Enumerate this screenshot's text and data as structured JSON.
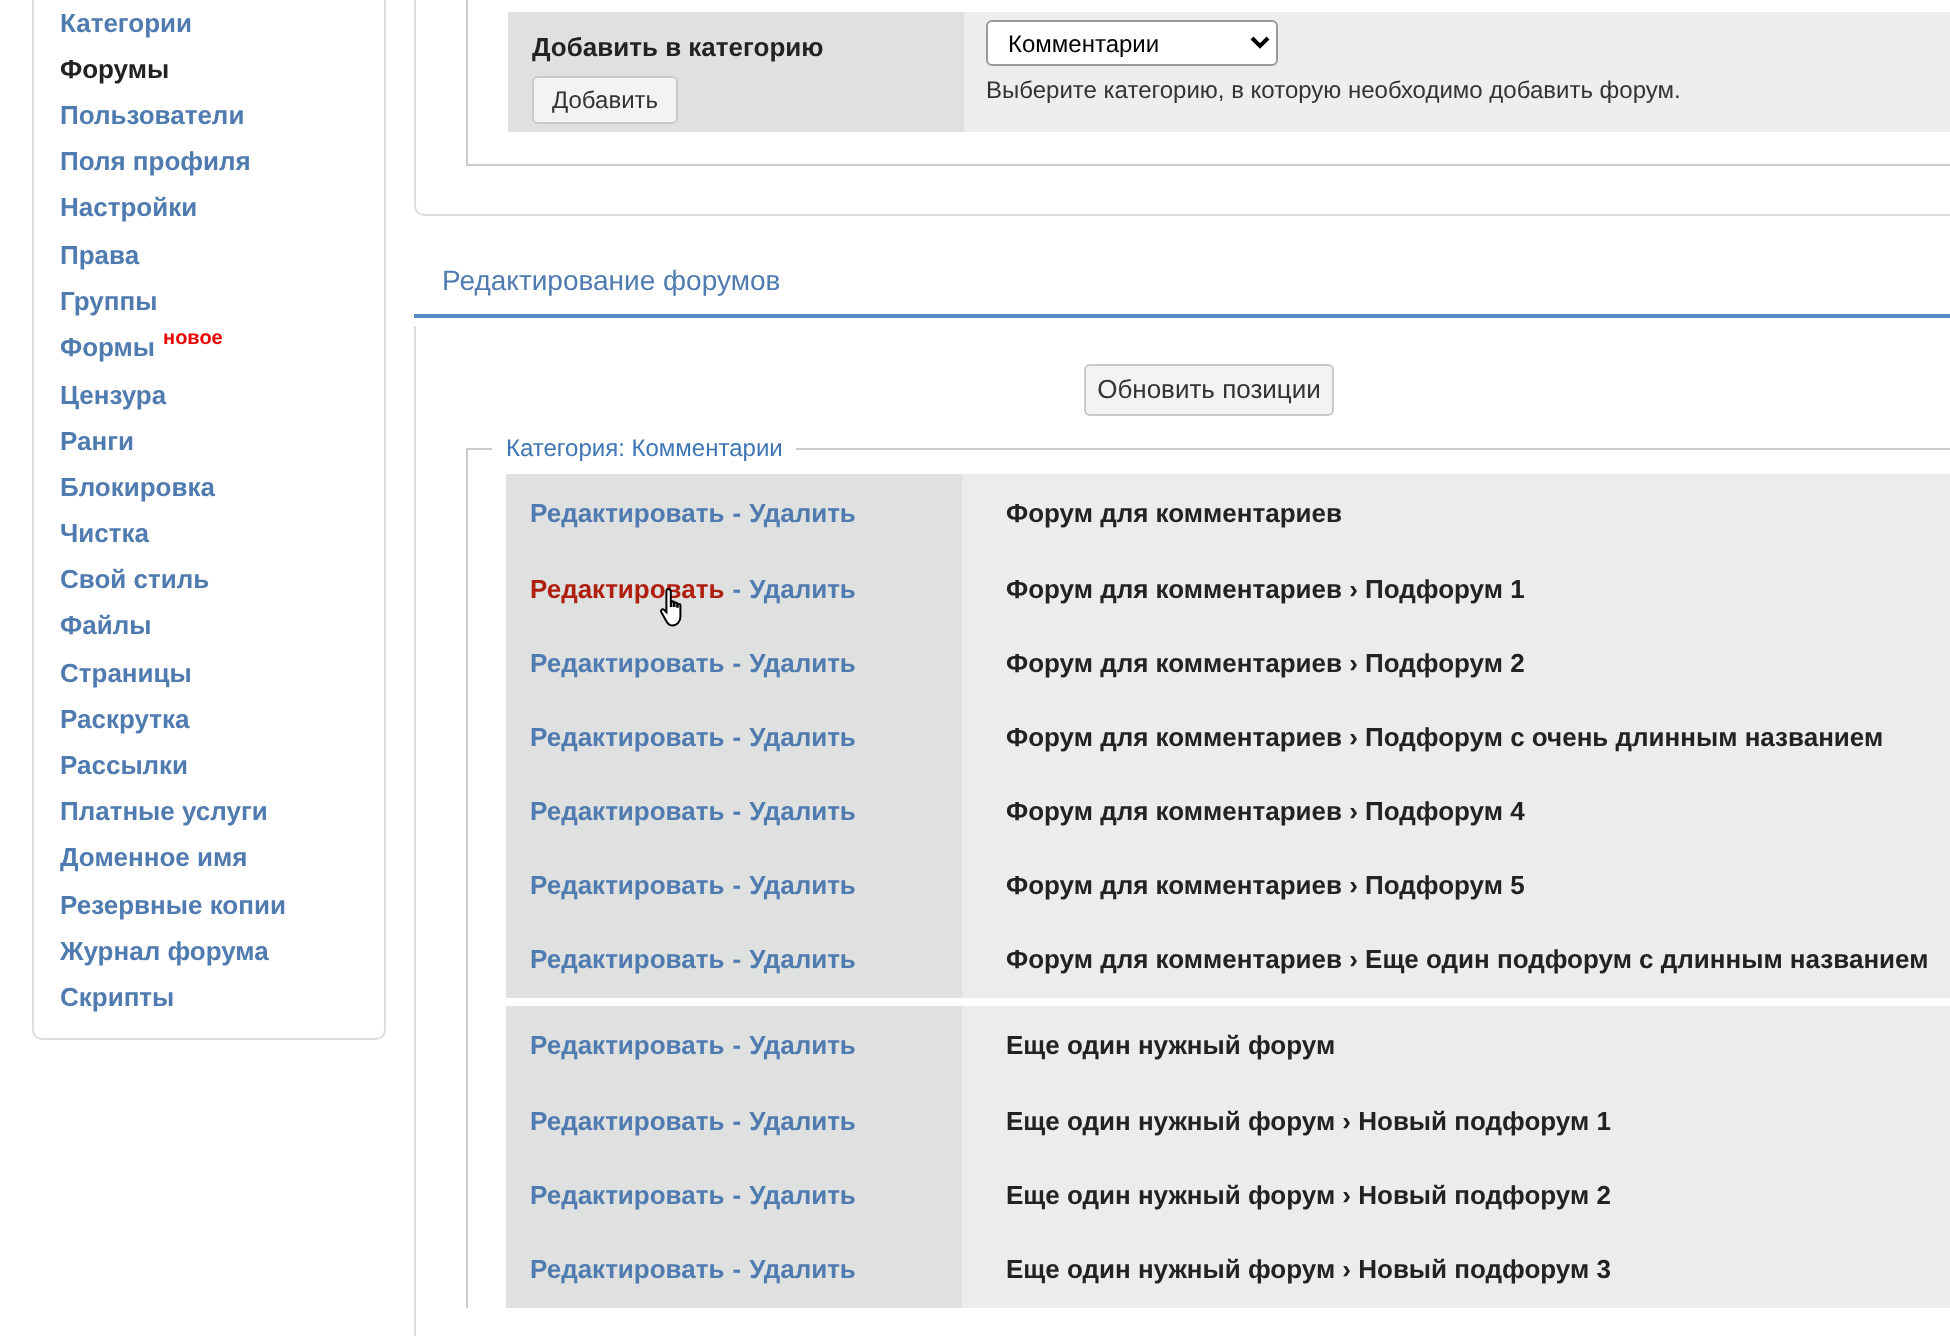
{
  "sidebar": {
    "items": [
      {
        "label": "Категории",
        "selected": false
      },
      {
        "label": "Форумы",
        "selected": true
      },
      {
        "label": "Пользователи",
        "selected": false
      },
      {
        "label": "Поля профиля",
        "selected": false
      },
      {
        "label": "Настройки",
        "selected": false
      },
      {
        "label": "Права",
        "selected": false
      },
      {
        "label": "Группы",
        "selected": false
      },
      {
        "label": "Формы",
        "selected": false,
        "badge": "новое"
      },
      {
        "label": "Цензура",
        "selected": false
      },
      {
        "label": "Ранги",
        "selected": false
      },
      {
        "label": "Блокировка",
        "selected": false
      },
      {
        "label": "Чистка",
        "selected": false
      },
      {
        "label": "Свой стиль",
        "selected": false
      },
      {
        "label": "Файлы",
        "selected": false
      },
      {
        "label": "Страницы",
        "selected": false
      },
      {
        "label": "Раскрутка",
        "selected": false
      },
      {
        "label": "Рассылки",
        "selected": false
      },
      {
        "label": "Платные услуги",
        "selected": false
      },
      {
        "label": "Доменное имя",
        "selected": false
      },
      {
        "label": "Резервные копии",
        "selected": false
      },
      {
        "label": "Журнал форума",
        "selected": false
      },
      {
        "label": "Скрипты",
        "selected": false
      }
    ]
  },
  "add_forum": {
    "label": "Добавить в категорию",
    "button": "Добавить",
    "select": {
      "value": "Комментарии"
    },
    "hint": "Выберите категорию, в которую необходимо добавить форум."
  },
  "section_title": "Редактирование форумов",
  "update_button": "Обновить позиции",
  "category": {
    "legend": "Категория: Комментарии",
    "groups": [
      {
        "rows": [
          {
            "edit": "Редактировать",
            "separator": "-",
            "delete": "Удалить",
            "hovered": false,
            "name": "Форум для комментариев"
          },
          {
            "edit": "Редактировать",
            "separator": "-",
            "delete": "Удалить",
            "hovered": true,
            "name": "Форум для комментариев › Подфорум 1"
          },
          {
            "edit": "Редактировать",
            "separator": "-",
            "delete": "Удалить",
            "hovered": false,
            "name": "Форум для комментариев › Подфорум 2"
          },
          {
            "edit": "Редактировать",
            "separator": "-",
            "delete": "Удалить",
            "hovered": false,
            "name": "Форум для комментариев › Подфорум с очень длинным названием"
          },
          {
            "edit": "Редактировать",
            "separator": "-",
            "delete": "Удалить",
            "hovered": false,
            "name": "Форум для комментариев › Подфорум 4"
          },
          {
            "edit": "Редактировать",
            "separator": "-",
            "delete": "Удалить",
            "hovered": false,
            "name": "Форум для комментариев › Подфорум 5"
          },
          {
            "edit": "Редактировать",
            "separator": "-",
            "delete": "Удалить",
            "hovered": false,
            "name": "Форум для комментариев › Еще один подфорум с длинным названием"
          }
        ]
      },
      {
        "rows": [
          {
            "edit": "Редактировать",
            "separator": "-",
            "delete": "Удалить",
            "hovered": false,
            "name": "Еще один нужный форум"
          },
          {
            "edit": "Редактировать",
            "separator": "-",
            "delete": "Удалить",
            "hovered": false,
            "name": "Еще один нужный форум › Новый подфорум 1"
          },
          {
            "edit": "Редактировать",
            "separator": "-",
            "delete": "Удалить",
            "hovered": false,
            "name": "Еще один нужный форум › Новый подфорум 2"
          },
          {
            "edit": "Редактировать",
            "separator": "-",
            "delete": "Удалить",
            "hovered": false,
            "name": "Еще один нужный форум › Новый подфорум 3"
          }
        ]
      }
    ]
  }
}
